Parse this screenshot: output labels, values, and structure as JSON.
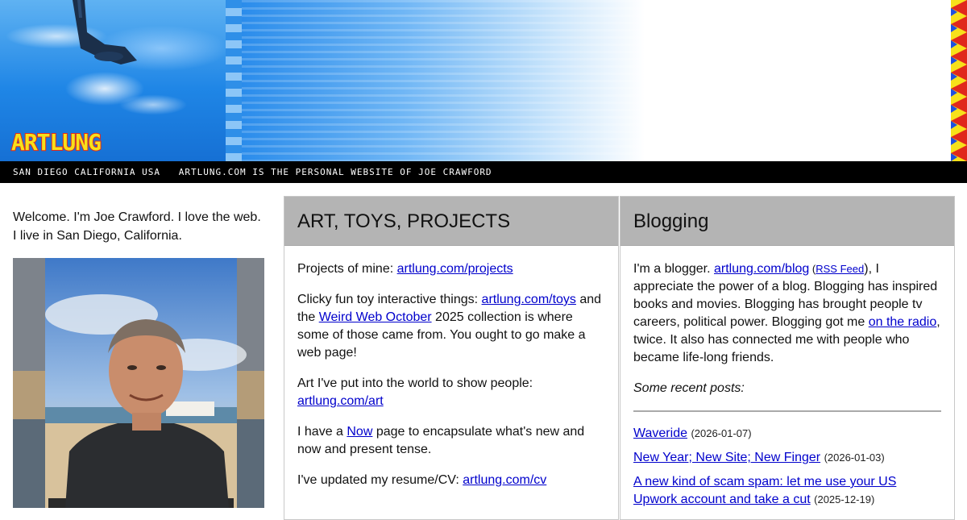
{
  "header": {
    "logo_text": "ARTLUNG",
    "tagline": "SAN DIEGO CALIFORNIA USA   ARTLUNG.COM IS THE PERSONAL WEBSITE OF JOE CRAWFORD"
  },
  "intro": {
    "line1": "Welcome. I'm Joe Crawford. I love the web.",
    "line2": "I live in San Diego, California."
  },
  "art_panel": {
    "title": "ART, TOYS, PROJECTS",
    "p1_text": "Projects of mine: ",
    "p1_link": "artlung.com/projects",
    "p2_text_a": "Clicky fun toy interactive things: ",
    "p2_link_a": "artlung.com/toys",
    "p2_text_b": " and the ",
    "p2_link_b": "Weird Web October",
    "p2_text_c": " 2025 collection is where some of those came from. You ought to go make a web page!",
    "p3_text": "Art I've put into the world to show people: ",
    "p3_link": "artlung.com/art",
    "p4_text_a": "I have a ",
    "p4_link": "Now",
    "p4_text_b": " page to encapsulate what's new and now and present tense.",
    "p5_text": "I've updated my resume/CV: ",
    "p5_link": "artlung.com/cv"
  },
  "blog_panel": {
    "title": "Blogging",
    "p1_text_a": "I'm a blogger. ",
    "p1_link_blog": "artlung.com/blog",
    "p1_paren_open": " (",
    "p1_link_rss": "RSS Feed",
    "p1_text_b": "), I appreciate the power of a blog. Blogging has inspired books and movies. Blogging has brought people tv careers, political power. Blogging got me ",
    "p1_link_radio": "on the radio",
    "p1_text_c": ", twice. It also has connected me with people who became life-long friends.",
    "recent_label": "Some recent posts:",
    "posts": [
      {
        "title": "Waveride",
        "date": "(2026-01-07)"
      },
      {
        "title": "New Year; New Site; New Finger",
        "date": "(2026-01-03)"
      },
      {
        "title": "A new kind of scam spam: let me use your US Upwork account and take a cut",
        "date": "(2025-12-19)"
      }
    ]
  },
  "colors": {
    "header_blue": "#1f86e6",
    "panel_header_gray": "#b4b4b4",
    "link_blue": "#0000cc",
    "logo_yellow": "#f7e11a",
    "logo_red": "#e0281c"
  }
}
